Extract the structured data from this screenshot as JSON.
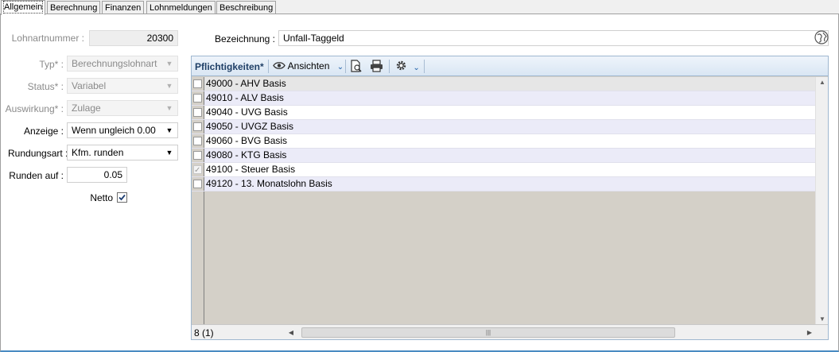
{
  "tabs": [
    {
      "label": "Allgemein",
      "active": true
    },
    {
      "label": "Berechnung",
      "active": false
    },
    {
      "label": "Finanzen",
      "active": false
    },
    {
      "label": "Lohnmeldungen",
      "active": false
    },
    {
      "label": "Beschreibung",
      "active": false
    }
  ],
  "form": {
    "lohnartnummer_label": "Lohnartnummer :",
    "lohnartnummer_value": "20300",
    "typ_label": "Typ* :",
    "typ_value": "Berechnungslohnart",
    "status_label": "Status* :",
    "status_value": "Variabel",
    "auswirkung_label": "Auswirkung* :",
    "auswirkung_value": "Zulage",
    "anzeige_label": "Anzeige :",
    "anzeige_value": "Wenn ungleich 0.00",
    "rundungsart_label": "Rundungsart :",
    "rundungsart_value": "Kfm. runden",
    "runden_auf_label": "Runden auf :",
    "runden_auf_value": "0.05",
    "netto_label": "Netto",
    "netto_checked": true,
    "bezeichnung_label": "Bezeichnung :",
    "bezeichnung_value": "Unfall-Taggeld"
  },
  "grid": {
    "title": "Pflichtigkeiten*",
    "ansichten_label": "Ansichten",
    "rows": [
      {
        "label": "49000 - AHV Basis",
        "checked": false,
        "disabled": false
      },
      {
        "label": "49010 - ALV Basis",
        "checked": false,
        "disabled": false
      },
      {
        "label": "49040 - UVG Basis",
        "checked": false,
        "disabled": false
      },
      {
        "label": "49050 - UVGZ Basis",
        "checked": false,
        "disabled": false
      },
      {
        "label": "49060 - BVG Basis",
        "checked": false,
        "disabled": false
      },
      {
        "label": "49080 - KTG Basis",
        "checked": false,
        "disabled": false
      },
      {
        "label": "49100 - Steuer Basis",
        "checked": true,
        "disabled": true
      },
      {
        "label": "49120 - 13. Monatslohn Basis",
        "checked": false,
        "disabled": false
      }
    ],
    "count": "8 (1)"
  },
  "colors": {
    "accent": "#4a8bc2",
    "toolbar_title": "#1f3f66",
    "alt_row": "#ebebf8"
  }
}
